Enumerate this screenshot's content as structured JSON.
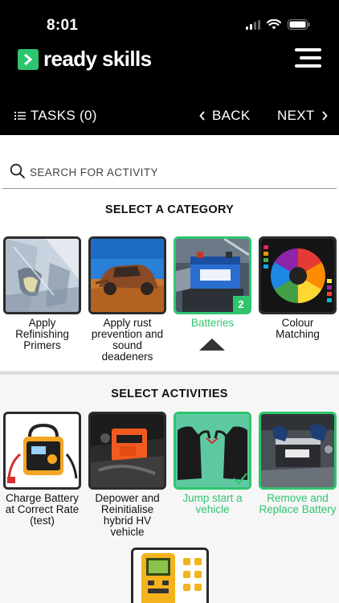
{
  "status_bar": {
    "time": "8:01"
  },
  "header": {
    "brand": "ready skills",
    "tasks_label": "TASKS (0)",
    "back_label": "BACK",
    "next_label": "NEXT"
  },
  "search": {
    "placeholder": "SEARCH FOR ACTIVITY"
  },
  "categories": {
    "title": "SELECT A CATEGORY",
    "items": [
      {
        "label": "Apply Refinishing Primers",
        "selected": false
      },
      {
        "label": "Apply rust prevention and sound deadeners",
        "selected": false
      },
      {
        "label": "Batteries",
        "selected": true,
        "badge": "2"
      },
      {
        "label": "Colour Matching",
        "selected": false
      }
    ]
  },
  "activities": {
    "title": "SELECT ACTIVITIES",
    "items": [
      {
        "label": "Charge Battery at Correct Rate (test)",
        "selected": false
      },
      {
        "label": "Depower and Reinitialise hybrid HV vehicle",
        "selected": false
      },
      {
        "label": "Jump start a vehicle",
        "selected": true
      },
      {
        "label": "Remove and Replace Battery",
        "selected": true
      }
    ]
  },
  "colors": {
    "accent": "#2fc56f",
    "header_bg": "#000000"
  }
}
